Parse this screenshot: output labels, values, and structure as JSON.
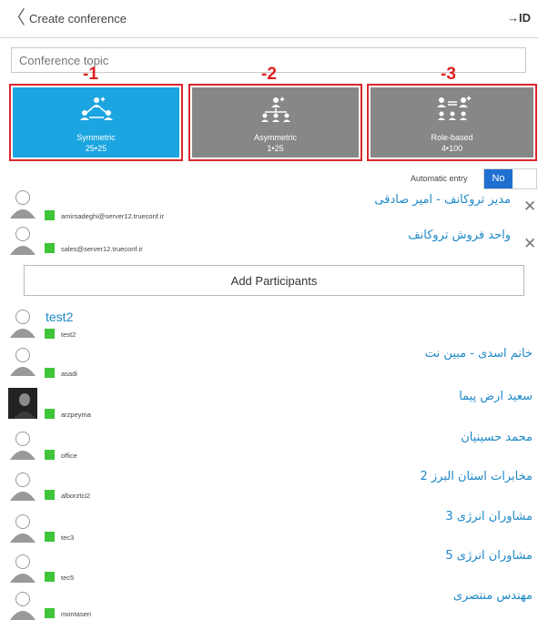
{
  "header": {
    "back_icon": "chevron-left-icon",
    "title": "Create conference",
    "id_label": "→ID"
  },
  "topic": {
    "placeholder": "Conference topic"
  },
  "annotations": {
    "marker_1": "-1",
    "marker_2": "-2",
    "marker_3": "-3",
    "color": "#e0201e"
  },
  "modes": [
    {
      "label": "Symmetric",
      "sub": "25•25",
      "selected": true,
      "icon": "symmetric-icon"
    },
    {
      "label": "Asymmetric",
      "sub": "1•25",
      "selected": false,
      "icon": "asymmetric-icon"
    },
    {
      "label": "Role-based",
      "sub": "4•100",
      "selected": false,
      "icon": "role-based-icon"
    }
  ],
  "auto_entry": {
    "label": "Automatic entry",
    "value": "No"
  },
  "selected_participants": [
    {
      "name": "مدیر تروکانف - امیر صادقی",
      "login": "amirsadeghi@server12.trueconf.ir"
    },
    {
      "name": "واحد فروش تروکانف",
      "login": "sales@server12.trueconf.ir"
    }
  ],
  "add_button": "Add Participants",
  "contacts": [
    {
      "name": "test2",
      "login": "test2"
    },
    {
      "name": "خانم اسدی - مبین نت",
      "login": "asadi"
    },
    {
      "name": "سعید ارض پیما",
      "login": "arzpeyma"
    },
    {
      "name": "محمد حسینیان",
      "login": "office"
    },
    {
      "name": "مخابرات استان البرز 2",
      "login": "alborztci2"
    },
    {
      "name": "مشاوران انرژی 3",
      "login": "tec3"
    },
    {
      "name": "مشاوران انرژی 5",
      "login": "tec5"
    },
    {
      "name": "مهندس منتصری",
      "login": "montaseri"
    }
  ],
  "colors": {
    "accent": "#1ba5e1",
    "link": "#1e88c8",
    "status_online": "#3fc43a",
    "toggle_on": "#1f6fd1"
  }
}
